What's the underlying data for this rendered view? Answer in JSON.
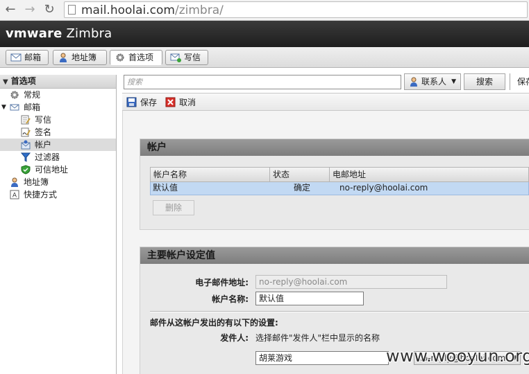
{
  "browser": {
    "back": "←",
    "forward": "→",
    "reload": "↻",
    "url_host": "mail.hoolai.com",
    "url_path": "/zimbra/"
  },
  "app": {
    "logo_vm": "vmware",
    "logo_product": " Zimbra"
  },
  "tabs": [
    {
      "label": "邮箱",
      "icon": "mail-icon"
    },
    {
      "label": "地址簿",
      "icon": "contact-icon"
    },
    {
      "label": "首选项",
      "icon": "gear-icon"
    },
    {
      "label": "写信",
      "icon": "compose-icon"
    }
  ],
  "sidebar": {
    "title": "首选项",
    "items": [
      {
        "label": "常规",
        "icon": "gear-icon",
        "level": 0
      },
      {
        "label": "邮箱",
        "icon": "mail-icon",
        "level": 0
      },
      {
        "label": "写信",
        "icon": "compose-icon",
        "level": 1
      },
      {
        "label": "签名",
        "icon": "signature-icon",
        "level": 1
      },
      {
        "label": "帐户",
        "icon": "account-icon",
        "level": 1,
        "selected": true
      },
      {
        "label": "过滤器",
        "icon": "filter-icon",
        "level": 1
      },
      {
        "label": "可信地址",
        "icon": "shield-icon",
        "level": 1
      },
      {
        "label": "地址簿",
        "icon": "contact-icon",
        "level": 0
      },
      {
        "label": "快捷方式",
        "icon": "shortcut-icon",
        "level": 0
      }
    ]
  },
  "search": {
    "placeholder": "搜索",
    "contacts_label": "联系人",
    "search_button": "搜索",
    "save_label": "保存"
  },
  "actions": {
    "save": "保存",
    "cancel": "取消"
  },
  "accounts": {
    "title": "帐户",
    "columns": [
      "帐户名称",
      "状态",
      "电邮地址"
    ],
    "rows": [
      {
        "name": "默认值",
        "status": "确定",
        "email": "no-reply@hoolai.com"
      }
    ],
    "delete_button": "删除"
  },
  "primary": {
    "title": "主要帐户设定值",
    "email_label": "电子邮件地址:",
    "email_value": "no-reply@hoolai.com",
    "name_label": "帐户名称:",
    "name_value": "默认值",
    "sent_heading": "邮件从这帐户发出的有以下的设置:",
    "from_label": "发件人:",
    "from_desc": "选择邮件\"发件人\"栏中显示的名称",
    "from_name_value": "胡莱游戏",
    "from_address_value": "no-reply@hoolai.com"
  },
  "watermark": "www.wooyun.org"
}
